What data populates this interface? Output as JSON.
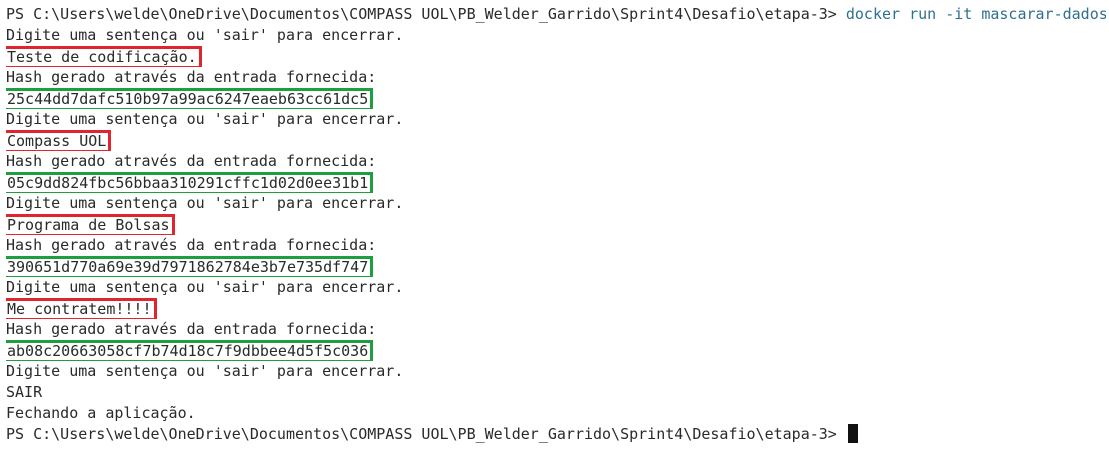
{
  "terminal": {
    "lines": [
      {
        "type": "prompt",
        "text": "PS C:\\Users\\welde\\OneDrive\\Documentos\\COMPASS UOL\\PB_Welder_Garrido\\Sprint4\\Desafio\\etapa-3> ",
        "command": "docker run -it mascarar-dados"
      },
      {
        "type": "text",
        "text": "Digite uma sentença ou 'sair' para encerrar."
      },
      {
        "type": "input",
        "text": "Teste de codificação."
      },
      {
        "type": "text",
        "text": "Hash gerado através da entrada fornecida:"
      },
      {
        "type": "hash",
        "text": "25c44dd7dafc510b97a99ac6247eaeb63cc61dc5"
      },
      {
        "type": "text",
        "text": "Digite uma sentença ou 'sair' para encerrar."
      },
      {
        "type": "input",
        "text": "Compass UOL"
      },
      {
        "type": "text",
        "text": "Hash gerado através da entrada fornecida:"
      },
      {
        "type": "hash",
        "text": "05c9dd824fbc56bbaa310291cffc1d02d0ee31b1"
      },
      {
        "type": "text",
        "text": "Digite uma sentença ou 'sair' para encerrar."
      },
      {
        "type": "input",
        "text": "Programa de Bolsas"
      },
      {
        "type": "text",
        "text": "Hash gerado através da entrada fornecida:"
      },
      {
        "type": "hash",
        "text": "390651d770a69e39d7971862784e3b7e735df747"
      },
      {
        "type": "text",
        "text": "Digite uma sentença ou 'sair' para encerrar."
      },
      {
        "type": "input",
        "text": "Me contratem!!!!"
      },
      {
        "type": "text",
        "text": "Hash gerado através da entrada fornecida:"
      },
      {
        "type": "hash",
        "text": "ab08c20663058cf7b74d18c7f9dbbee4d5f5c036"
      },
      {
        "type": "text",
        "text": "Digite uma sentença ou 'sair' para encerrar."
      },
      {
        "type": "text",
        "text": "SAIR"
      },
      {
        "type": "text",
        "text": "Fechando a aplicação."
      },
      {
        "type": "prompt-final",
        "text": "PS C:\\Users\\welde\\OneDrive\\Documentos\\COMPASS UOL\\PB_Welder_Garrido\\Sprint4\\Desafio\\etapa-3> "
      }
    ]
  },
  "colors": {
    "background": "#ffffff",
    "text": "#2a2a2a",
    "command": "#2f6f8f",
    "input_highlight": "#e1252f",
    "hash_highlight": "#1f9e40",
    "cursor": "#111111"
  }
}
